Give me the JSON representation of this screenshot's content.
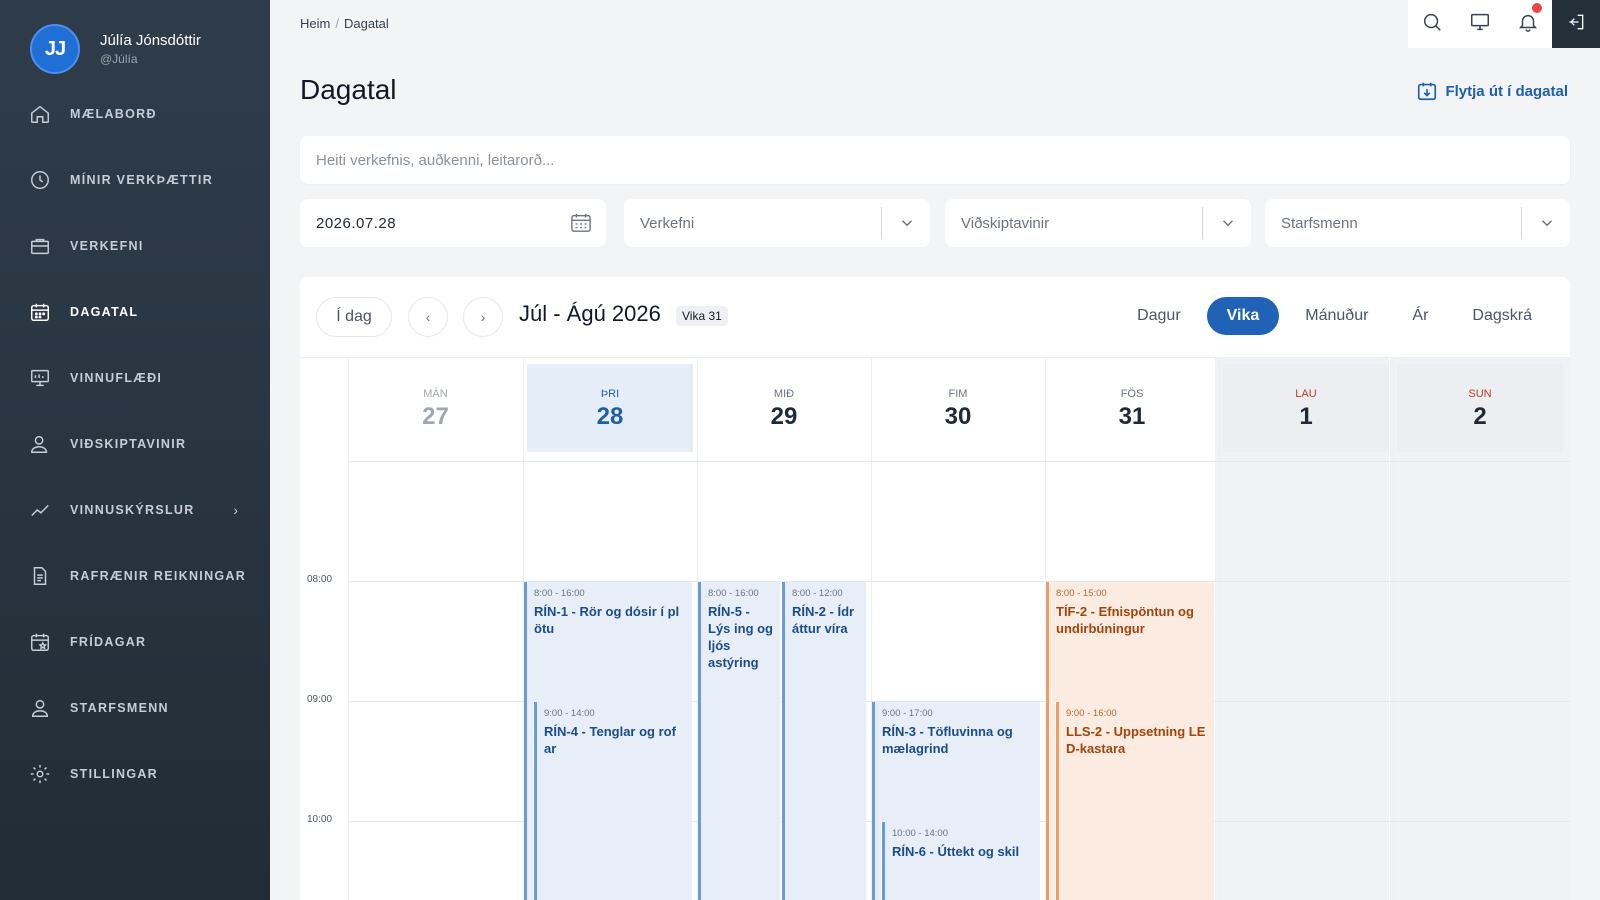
{
  "user": {
    "initials": "JJ",
    "name": "Júlía Jónsdóttir",
    "handle": "@Júlía"
  },
  "nav": [
    {
      "label": "MÆLABORÐ",
      "icon": "home-icon"
    },
    {
      "label": "MÍNIR VERKÞÆTTIR",
      "icon": "clock-icon"
    },
    {
      "label": "VERKEFNI",
      "icon": "briefcase-icon"
    },
    {
      "label": "DAGATAL",
      "icon": "calendar-icon",
      "active": true
    },
    {
      "label": "VINNUFLÆÐI",
      "icon": "workflow-board-icon"
    },
    {
      "label": "VIÐSKIPTAVINIR",
      "icon": "user-icon"
    },
    {
      "label": "VINNUSKÝRSLUR",
      "icon": "trend-icon",
      "has_submenu": true
    },
    {
      "label": "RAFRÆNIR REIKNINGAR",
      "icon": "document-icon"
    },
    {
      "label": "FRÍDAGAR",
      "icon": "calendar-star-icon"
    },
    {
      "label": "STARFSMENN",
      "icon": "users-icon"
    },
    {
      "label": "STILLINGAR",
      "icon": "gear-icon"
    }
  ],
  "breadcrumb": {
    "home": "Heim",
    "current": "Dagatal"
  },
  "page_title": "Dagatal",
  "export_label": "Flytja út í dagatal",
  "search_placeholder": "Heiti verkefnis, auðkenni, leitarorð...",
  "filters": {
    "date_value": "2026.07.28",
    "project_placeholder": "Verkefni",
    "customers_placeholder": "Viðskiptavinir",
    "staff_placeholder": "Starfsmenn"
  },
  "calendar": {
    "today_label": "Í dag",
    "range_title": "Júl - Ágú 2026",
    "week_badge": "Vika 31",
    "views": [
      "Dagur",
      "Vika",
      "Mánuður",
      "Ár",
      "Dagskrá"
    ],
    "active_view": "Vika",
    "days": [
      {
        "name": "MÁN",
        "date": "27",
        "state": "past"
      },
      {
        "name": "ÞRI",
        "date": "28",
        "state": "today"
      },
      {
        "name": "MIÐ",
        "date": "29",
        "state": "normal"
      },
      {
        "name": "FIM",
        "date": "30",
        "state": "normal"
      },
      {
        "name": "FÖS",
        "date": "31",
        "state": "normal"
      },
      {
        "name": "LAU",
        "date": "1",
        "state": "weekend"
      },
      {
        "name": "SUN",
        "date": "2",
        "state": "weekend"
      }
    ],
    "time_labels": [
      "08:00",
      "09:00",
      "10:00"
    ],
    "events": [
      {
        "day": 1,
        "time": "8:00 - 16:00",
        "title": "RÍN-1 - Rör og dósir í pl ötu",
        "color": "blue"
      },
      {
        "day": 1,
        "time": "9:00 - 14:00",
        "title": "RÍN-4 - Tenglar og rof ar",
        "color": "blue"
      },
      {
        "day": 2,
        "time": "8:00 - 16:00",
        "title": "RÍN-5 - Lýs ing og ljós astýring",
        "color": "blue"
      },
      {
        "day": 2,
        "time": "8:00 - 12:00",
        "title": "RÍN-2 - Ídr áttur víra",
        "color": "blue"
      },
      {
        "day": 3,
        "time": "9:00 - 17:00",
        "title": "RÍN-3 - Töfluvinna og mælagrind",
        "color": "blue"
      },
      {
        "day": 3,
        "time": "10:00 - 14:00",
        "title": "RÍN-6 - Úttekt og skil",
        "color": "blue"
      },
      {
        "day": 4,
        "time": "8:00 - 15:00",
        "title": "TÍF-2 - Efnispöntun og undirbúningur",
        "color": "orange"
      },
      {
        "day": 4,
        "time": "9:00 - 16:00",
        "title": "LLS-2 - Uppsetning LE D-kastara",
        "color": "orange"
      }
    ]
  },
  "colors": {
    "sidebar": "#2b3743",
    "accent": "#1f62b6",
    "event_blue": "#e7eef8",
    "event_orange": "#fcebe0"
  }
}
